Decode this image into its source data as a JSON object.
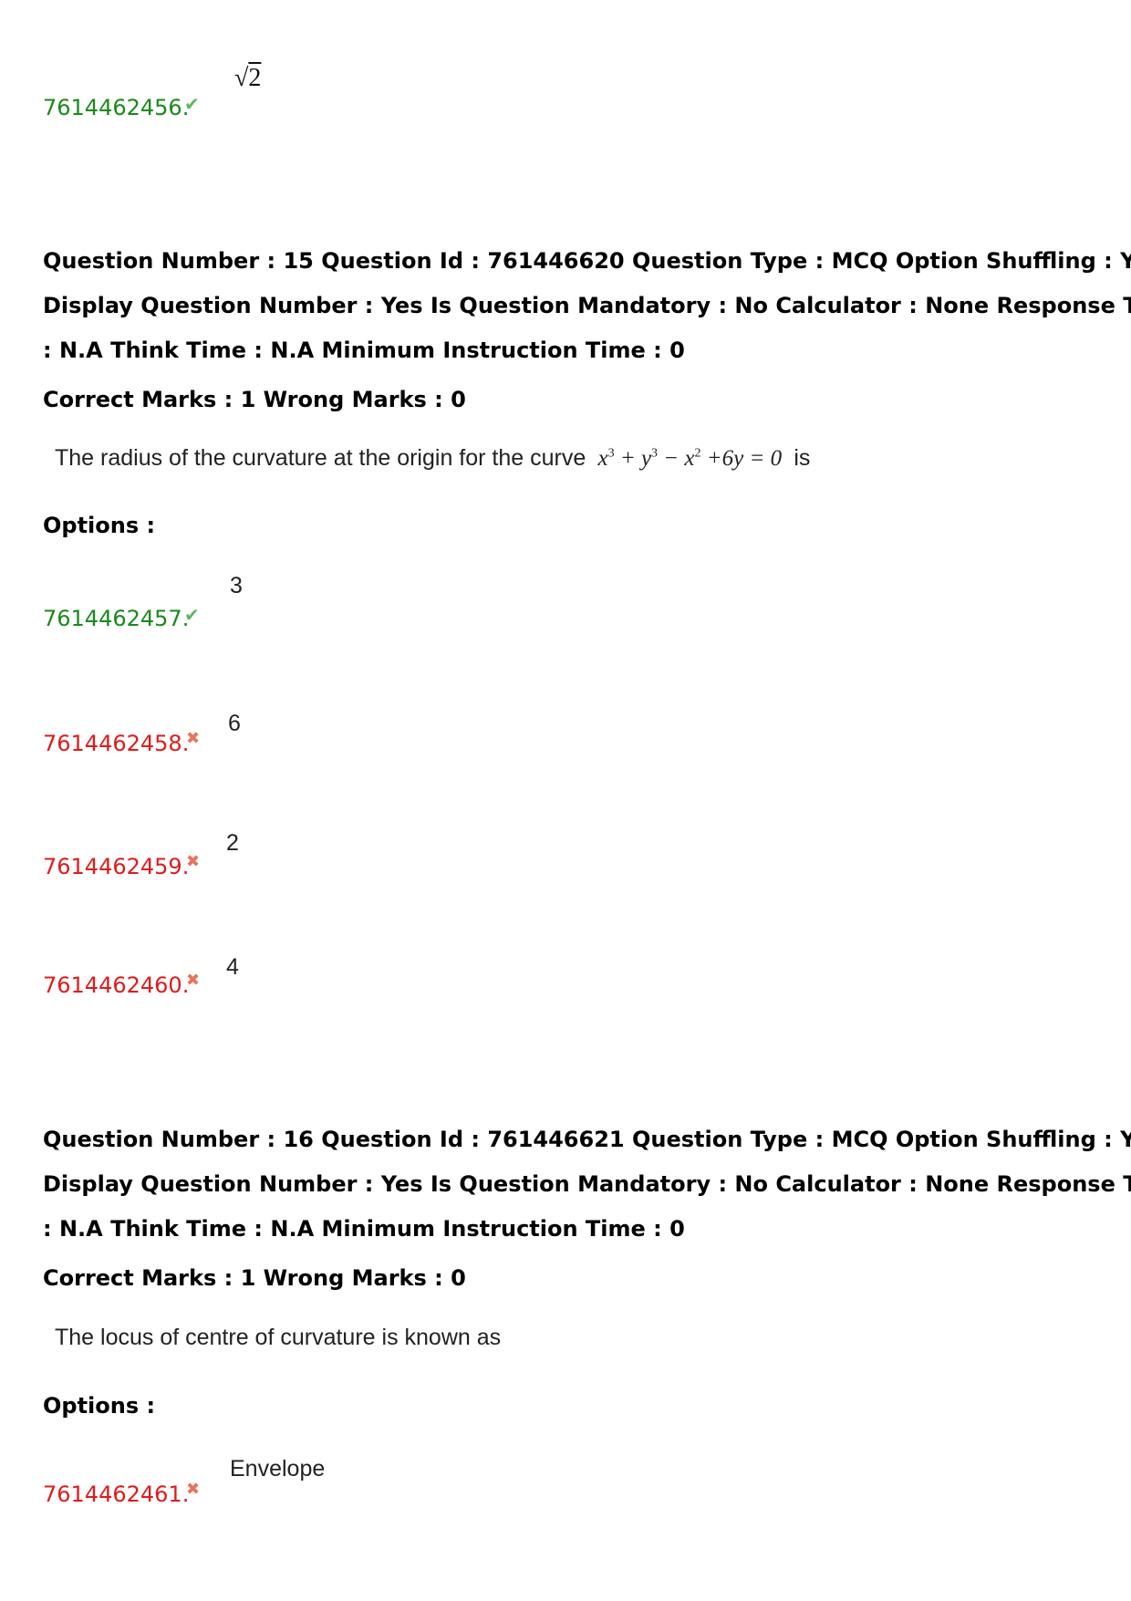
{
  "prev_question": {
    "options": [
      {
        "id": "7614462456.",
        "status": "correct",
        "icon": "check-icon",
        "value": "√2"
      }
    ]
  },
  "questions": [
    {
      "meta_lines": [
        "Question Number : 15 Question Id : 761446620 Question Type : MCQ Option Shuffling : Yes",
        "Display Question Number : Yes Is Question Mandatory : No Calculator : None Response Time",
        ": N.A Think Time : N.A Minimum Instruction Time : 0"
      ],
      "marks": "Correct Marks : 1 Wrong Marks : 0",
      "text": "The radius of the curvature at the origin for the curve",
      "equation": "x³ + y³ − x² + 6y = 0",
      "text_suffix": "is",
      "options_label": "Options :",
      "options": [
        {
          "id": "7614462457.",
          "status": "correct",
          "icon": "check-icon",
          "value": "3"
        },
        {
          "id": "7614462458.",
          "status": "wrong",
          "icon": "cross-icon",
          "value": "6"
        },
        {
          "id": "7614462459.",
          "status": "wrong",
          "icon": "cross-icon",
          "value": "2"
        },
        {
          "id": "7614462460.",
          "status": "wrong",
          "icon": "cross-icon",
          "value": "4"
        }
      ]
    },
    {
      "meta_lines": [
        "Question Number : 16 Question Id : 761446621 Question Type : MCQ Option Shuffling : Yes",
        "Display Question Number : Yes Is Question Mandatory : No Calculator : None Response Time",
        ": N.A Think Time : N.A Minimum Instruction Time : 0"
      ],
      "marks": "Correct Marks : 1 Wrong Marks : 0",
      "text": "The locus of centre of curvature is known as",
      "options_label": "Options :",
      "options": [
        {
          "id": "7614462461.",
          "status": "wrong",
          "icon": "cross-icon",
          "value": "Envelope"
        }
      ]
    }
  ],
  "colors": {
    "correct_id": "#1a8a1a",
    "wrong_id": "#e01b1b",
    "check_mark": "#5cb85c",
    "cross_mark": "#e8735a"
  }
}
